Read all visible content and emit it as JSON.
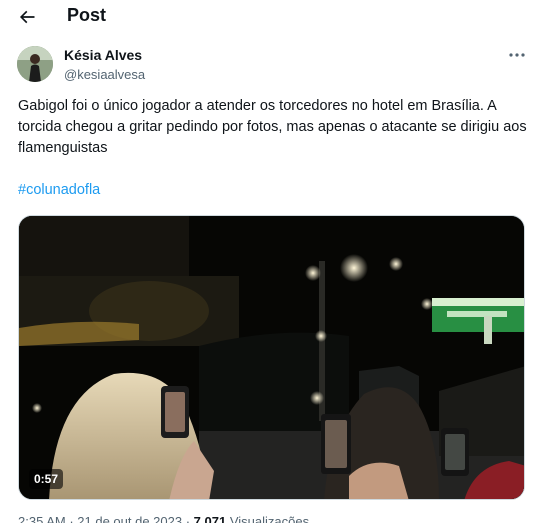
{
  "header": {
    "title": "Post"
  },
  "author": {
    "name": "Késia Alves",
    "handle": "@kesiaalvesa"
  },
  "tweet": {
    "text": "Gabigol foi o único jogador a atender os torcedores no hotel em Brasília. A torcida chegou a gritar pedindo por fotos, mas apenas o atacante se dirigiu aos flamenguistas",
    "hashtag": "#colunadofla"
  },
  "media": {
    "duration": "0:57"
  },
  "meta": {
    "time": "2:35 AM",
    "sep1": " · ",
    "date": "21 de out de 2023",
    "sep2": " · ",
    "views_count": "7.071",
    "views_label": " Visualizações"
  },
  "colors": {
    "accent": "#1d9bf0",
    "text": "#0f1419",
    "muted": "#536471",
    "gas_station_green": "#2fa84f"
  }
}
